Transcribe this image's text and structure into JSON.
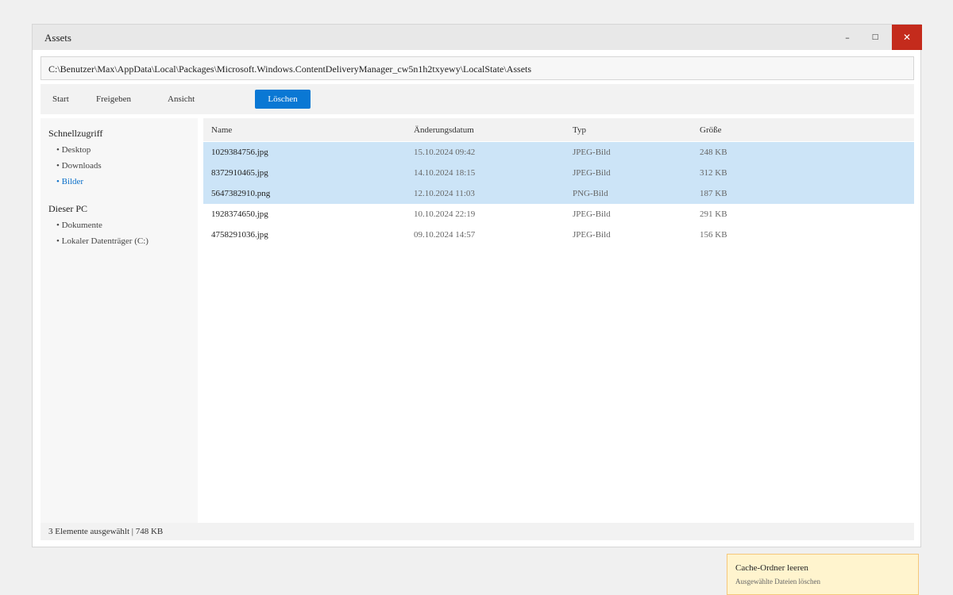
{
  "window": {
    "title": "Assets",
    "minimize_glyph": "–",
    "maximize_glyph": "□",
    "close_glyph": "✕"
  },
  "address": {
    "path": "C:\\Benutzer\\Max\\AppData\\Local\\Packages\\Microsoft.Windows.ContentDeliveryManager_cw5n1h2txyewy\\LocalState\\Assets"
  },
  "toolbar": {
    "start": "Start",
    "share": "Freigeben",
    "view": "Ansicht",
    "delete": "Löschen"
  },
  "sidebar": {
    "quick_access": "Schnellzugriff",
    "quick_items": [
      "• Desktop",
      "• Downloads",
      "• Bilder"
    ],
    "this_pc": "Dieser PC",
    "pc_items": [
      "• Dokumente",
      "• Lokaler Datenträger (C:)"
    ]
  },
  "columns": {
    "name": "Name",
    "date": "Änderungsdatum",
    "type": "Typ",
    "size": "Größe"
  },
  "files": [
    {
      "name": "1029384756.jpg",
      "date": "15.10.2024 09:42",
      "type": "JPEG-Bild",
      "size": "248 KB",
      "selected": true
    },
    {
      "name": "8372910465.jpg",
      "date": "14.10.2024 18:15",
      "type": "JPEG-Bild",
      "size": "312 KB",
      "selected": true
    },
    {
      "name": "5647382910.png",
      "date": "12.10.2024 11:03",
      "type": "PNG-Bild",
      "size": "187 KB",
      "selected": true
    },
    {
      "name": "1928374650.jpg",
      "date": "10.10.2024 22:19",
      "type": "JPEG-Bild",
      "size": "291 KB",
      "selected": false
    },
    {
      "name": "4758291036.jpg",
      "date": "09.10.2024 14:57",
      "type": "JPEG-Bild",
      "size": "156 KB",
      "selected": false
    }
  ],
  "tooltip": {
    "title": "Cache-Ordner leeren",
    "subtitle": "Ausgewählte Dateien löschen"
  },
  "status": {
    "text": "3 Elemente ausgewählt | 748 KB"
  },
  "colors": {
    "accent": "#0a78d4",
    "selection": "#cce4f7",
    "close": "#c42b1c",
    "tooltip_bg": "#fff4ce"
  }
}
